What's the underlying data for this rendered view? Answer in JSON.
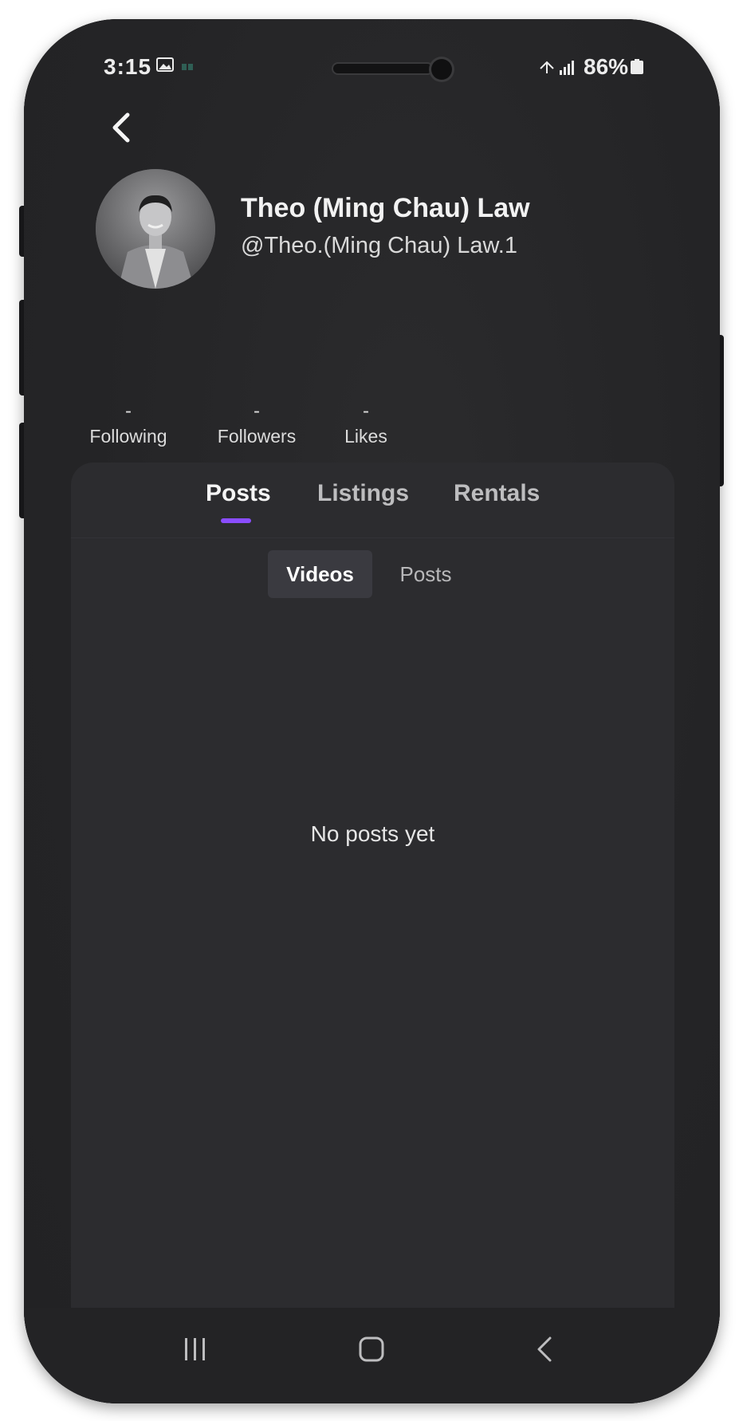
{
  "status_bar": {
    "time": "3:15",
    "battery": "86%"
  },
  "profile": {
    "name": "Theo (Ming Chau) Law",
    "handle": "@Theo.(Ming Chau) Law.1"
  },
  "stats": [
    {
      "value": "-",
      "label": "Following"
    },
    {
      "value": "-",
      "label": "Followers"
    },
    {
      "value": "-",
      "label": "Likes"
    }
  ],
  "tabs": [
    {
      "label": "Posts",
      "active": true
    },
    {
      "label": "Listings",
      "active": false
    },
    {
      "label": "Rentals",
      "active": false
    }
  ],
  "subtabs": [
    {
      "label": "Videos",
      "active": true
    },
    {
      "label": "Posts",
      "active": false
    }
  ],
  "empty_state": "No posts yet",
  "colors": {
    "accent": "#8a4dff",
    "background": "#242426",
    "card": "#2c2c2f"
  }
}
